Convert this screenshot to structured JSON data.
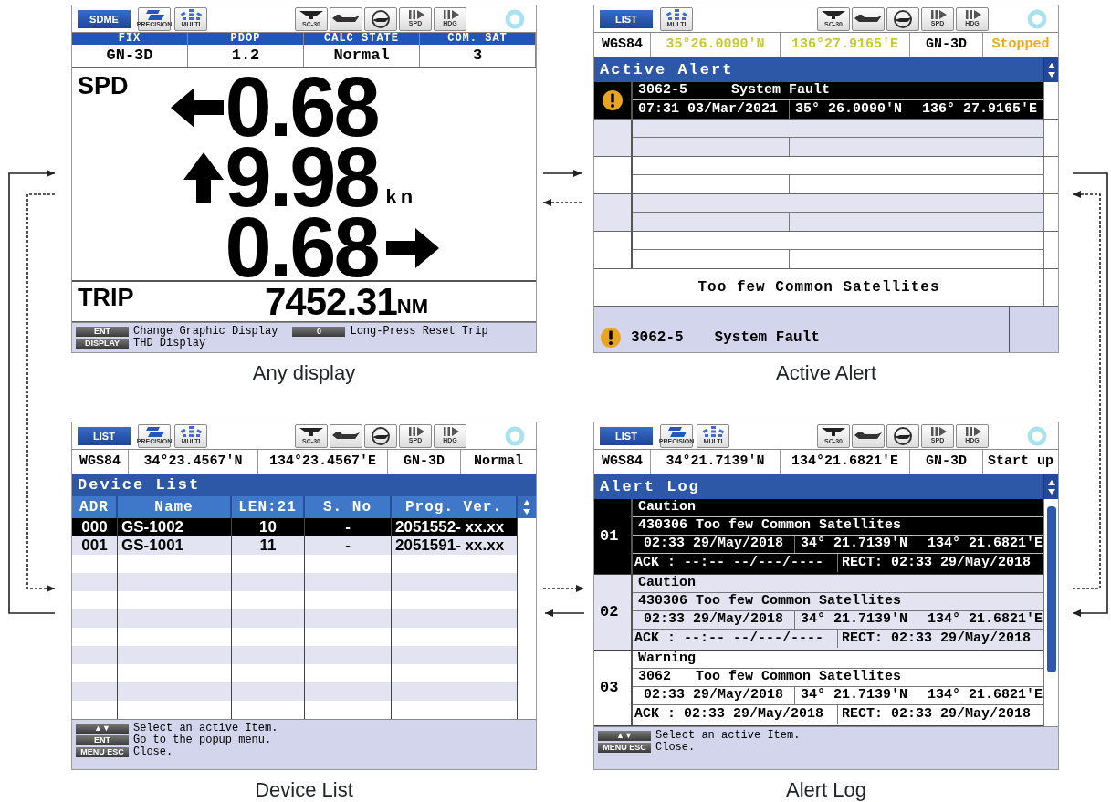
{
  "screens": [
    {
      "kind": "speed",
      "caption": "Any display",
      "mode": "SDME",
      "left_icons": [
        {
          "kind": "precision",
          "label": "PRECISION"
        },
        {
          "kind": "multi",
          "label": "MULTI"
        }
      ],
      "right_icons": [
        {
          "kind": "antenna",
          "label": "SC-30"
        },
        {
          "kind": "ship"
        },
        {
          "kind": "compass"
        },
        {
          "kind": "spd",
          "label": "SPD"
        },
        {
          "kind": "hdg",
          "label": "HDG"
        }
      ],
      "info": [
        {
          "heading": "FIX",
          "value": "GN-3D"
        },
        {
          "heading": "PDOP",
          "value": "1.2"
        },
        {
          "heading": "CALC STATE",
          "value": "Normal"
        },
        {
          "heading": "COM. SAT",
          "value": "3"
        }
      ],
      "speed": {
        "label": "SPD",
        "readings": [
          {
            "kind": "left",
            "value": "0.68"
          },
          {
            "kind": "up",
            "value": "9.98",
            "unit": "kn"
          },
          {
            "kind": "right",
            "value": "0.68"
          }
        ]
      },
      "trip": {
        "label": "TRIP",
        "value": "7452.31",
        "unit": "NM"
      },
      "footer": [
        {
          "key": "ENT",
          "text": "Change Graphic Display"
        },
        {
          "key": "DISPLAY",
          "text": "THD Display"
        },
        {
          "key": "0",
          "text": "Long-Press Reset Trip"
        }
      ]
    },
    {
      "kind": "active_alert",
      "caption": "Active Alert",
      "mode": "LIST",
      "left_icons": [
        {
          "kind": "multi",
          "label": "MULTI"
        }
      ],
      "right_icons": [
        {
          "kind": "antenna",
          "label": "SC-30"
        },
        {
          "kind": "ship"
        },
        {
          "kind": "compass"
        },
        {
          "kind": "spd",
          "label": "SPD"
        },
        {
          "kind": "hdg",
          "label": "HDG"
        }
      ],
      "status": [
        {
          "text": "WGS84",
          "color": "#000000"
        },
        {
          "text": "35°26.0090'N",
          "color": "#c4cc2c"
        },
        {
          "text": "136°27.9165'E",
          "color": "#c4cc2c"
        },
        {
          "text": "GN-3D",
          "color": "#000000"
        },
        {
          "text": "Stopped",
          "color": "#f0a81c"
        }
      ],
      "title": "Active Alert",
      "alerts": [
        {
          "code": "3062-5",
          "title": "System Fault",
          "time": "07:31 03/Mar/2021",
          "lat": "35° 26.0090'N",
          "lon": "136° 27.9165'E",
          "selected": true
        }
      ],
      "message": "Too few Common Satellites",
      "current": {
        "code": "3062-5",
        "title": "System Fault"
      }
    },
    {
      "kind": "device_list",
      "caption": "Device List",
      "mode": "LIST",
      "left_icons": [
        {
          "kind": "precision",
          "label": "PRECISION"
        },
        {
          "kind": "multi",
          "label": "MULTI"
        }
      ],
      "right_icons": [
        {
          "kind": "antenna",
          "label": "SC-30"
        },
        {
          "kind": "ship"
        },
        {
          "kind": "compass"
        },
        {
          "kind": "spd",
          "label": "SPD"
        },
        {
          "kind": "hdg",
          "label": "HDG"
        }
      ],
      "status": [
        {
          "text": "WGS84",
          "color": "#000000"
        },
        {
          "text": "34°23.4567'N",
          "color": "#000000"
        },
        {
          "text": "134°23.4567'E",
          "color": "#000000"
        },
        {
          "text": "GN-3D",
          "color": "#000000"
        },
        {
          "text": "Normal",
          "color": "#000000"
        }
      ],
      "title": "Device List",
      "columns": [
        "ADR",
        "Name",
        "LEN:21",
        "S. No",
        "Prog. Ver."
      ],
      "devices": [
        {
          "cells": [
            "000",
            "GS-1002",
            "10",
            "-",
            "2051552- xx.xx"
          ],
          "selected": true
        },
        {
          "cells": [
            "001",
            "GS-1001",
            "11",
            "-",
            "2051591- xx.xx"
          ],
          "selected": false
        }
      ],
      "footer": [
        {
          "key": "▲▼",
          "text": "Select an active Item."
        },
        {
          "key": "ENT",
          "text": "Go to the popup menu."
        },
        {
          "key": "MENU ESC",
          "text": "Close."
        }
      ]
    },
    {
      "kind": "alert_log",
      "caption": "Alert Log",
      "mode": "LIST",
      "left_icons": [
        {
          "kind": "precision",
          "label": "PRECISION"
        },
        {
          "kind": "multi",
          "label": "MULTI"
        }
      ],
      "right_icons": [
        {
          "kind": "antenna",
          "label": "SC-30"
        },
        {
          "kind": "ship"
        },
        {
          "kind": "compass"
        },
        {
          "kind": "spd",
          "label": "SPD"
        },
        {
          "kind": "hdg",
          "label": "HDG"
        }
      ],
      "status": [
        {
          "text": "WGS84",
          "color": "#000000"
        },
        {
          "text": "34°21.7139'N",
          "color": "#000000"
        },
        {
          "text": "134°21.6821'E",
          "color": "#000000"
        },
        {
          "text": "GN-3D",
          "color": "#000000"
        },
        {
          "text": "Start up",
          "color": "#000000"
        }
      ],
      "title": "Alert Log",
      "entries": [
        {
          "number": "01",
          "level": "Caution",
          "code": "430306",
          "message": "Too few Common Satellites",
          "time": "02:33 29/May/2018",
          "lat": "34° 21.7139'N",
          "lon": "134° 21.6821'E",
          "ack": "ACK : --:-- --/---/----",
          "rect": "RECT: 02:33 29/May/2018",
          "selected": true
        },
        {
          "number": "02",
          "level": "Caution",
          "code": "430306",
          "message": "Too few Common Satellites",
          "time": "02:33 29/May/2018",
          "lat": "34° 21.7139'N",
          "lon": "134° 21.6821'E",
          "ack": "ACK : --:-- --/---/----",
          "rect": "RECT: 02:33 29/May/2018",
          "selected": false
        },
        {
          "number": "03",
          "level": "Warning",
          "code": "3062",
          "message": "Too few Common Satellites",
          "time": "02:33 29/May/2018",
          "lat": "34° 21.7139'N",
          "lon": "134° 21.6821'E",
          "ack": "ACK : 02:33 29/May/2018",
          "rect": "RECT: 02:33 29/May/2018",
          "selected": false
        }
      ],
      "footer": [
        {
          "key": "▲▼",
          "text": "Select an active Item."
        },
        {
          "key": "MENU ESC",
          "text": "Close."
        }
      ]
    }
  ]
}
